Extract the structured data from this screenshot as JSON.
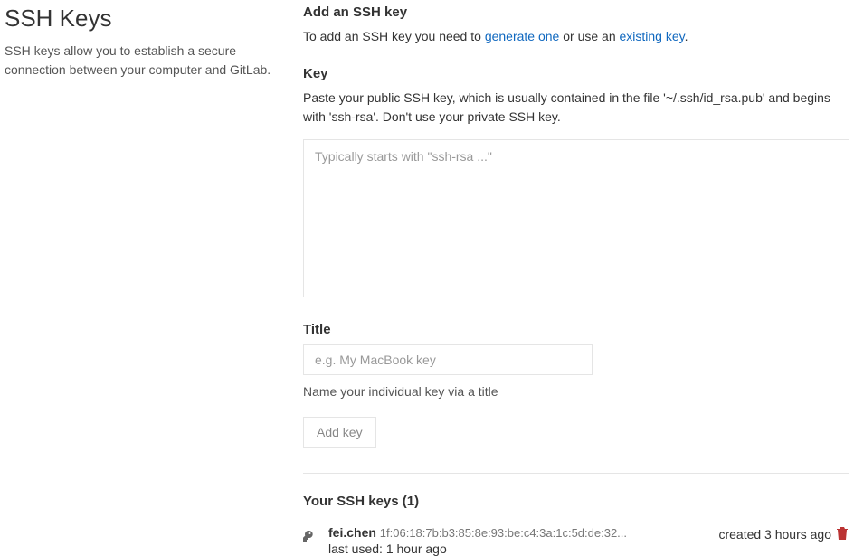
{
  "sidebar": {
    "title": "SSH Keys",
    "description": "SSH keys allow you to establish a secure connection between your computer and GitLab."
  },
  "form": {
    "heading": "Add an SSH key",
    "intro_prefix": "To add an SSH key you need to ",
    "generate_link": "generate one",
    "intro_mid": " or use an ",
    "existing_link": "existing key",
    "intro_suffix": ".",
    "key_label": "Key",
    "key_hint": "Paste your public SSH key, which is usually contained in the file '~/.ssh/id_rsa.pub' and begins with 'ssh-rsa'. Don't use your private SSH key.",
    "key_placeholder": "Typically starts with \"ssh-rsa ...\"",
    "title_label": "Title",
    "title_placeholder": "e.g. My MacBook key",
    "title_hint": "Name your individual key via a title",
    "submit_label": "Add key"
  },
  "keys": {
    "heading": "Your SSH keys (1)",
    "items": [
      {
        "name": "fei.chen",
        "fingerprint": "1f:06:18:7b:b3:85:8e:93:be:c4:3a:1c:5d:de:32...",
        "last_used": "last used: 1 hour ago",
        "created": "created 3 hours ago"
      }
    ]
  }
}
